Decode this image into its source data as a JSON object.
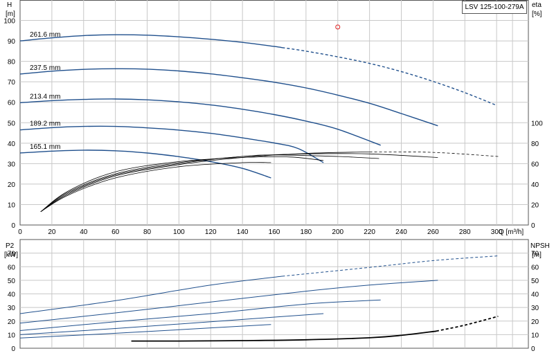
{
  "model": "LSV 125-100-279A",
  "chart_data": [
    {
      "type": "line",
      "title": "",
      "xlabel": "Q [m³/h]",
      "ylabel": "H [m]",
      "y2label": "eta [%]",
      "xlim": [
        0,
        320
      ],
      "ylim": [
        0,
        110
      ],
      "y2lim": [
        0,
        100
      ],
      "xticks": [
        0,
        20,
        40,
        60,
        80,
        100,
        120,
        140,
        160,
        180,
        200,
        220,
        240,
        260,
        280,
        300
      ],
      "yticks": [
        0,
        10,
        20,
        30,
        40,
        50,
        60,
        70,
        80,
        90,
        100
      ],
      "y2ticks": [
        0,
        20,
        40,
        60,
        80,
        100
      ],
      "grid": true,
      "left_unit_top": "H",
      "left_unit_bottom": "[m]",
      "right_unit_top": "eta",
      "right_unit_bottom": "[%]",
      "x_unit_label": "Q [m³/h]",
      "head_series": [
        {
          "name": "261.6 mm",
          "x": [
            0,
            20,
            40,
            60,
            80,
            100,
            120,
            140,
            160,
            180,
            200,
            220,
            240,
            260,
            280,
            300
          ],
          "y": [
            90,
            91.5,
            92.6,
            93,
            92.8,
            92,
            90.8,
            89.3,
            87.3,
            85,
            82.2,
            79,
            75,
            70.2,
            64.7,
            58.5
          ],
          "dashed_from": 165
        },
        {
          "name": "237.5 mm",
          "x": [
            0,
            20,
            40,
            60,
            80,
            100,
            120,
            140,
            160,
            180,
            200,
            220,
            240,
            263
          ],
          "y": [
            73.8,
            75.2,
            76.1,
            76.4,
            76.2,
            75.3,
            73.9,
            72,
            69.8,
            67,
            63.5,
            59.5,
            54.5,
            48.5
          ]
        },
        {
          "name": "213.4 mm",
          "x": [
            0,
            20,
            40,
            60,
            80,
            100,
            120,
            140,
            160,
            180,
            200,
            227
          ],
          "y": [
            59.8,
            60.8,
            61.4,
            61.6,
            61.2,
            60.2,
            58.7,
            56.6,
            54,
            50.8,
            46.8,
            39
          ]
        },
        {
          "name": "189.2 mm",
          "x": [
            0,
            20,
            40,
            60,
            80,
            100,
            120,
            140,
            160,
            175,
            191
          ],
          "y": [
            46.5,
            47.6,
            48.2,
            48.2,
            47.5,
            46.4,
            44.8,
            42.6,
            40.1,
            37.4,
            30.5
          ]
        },
        {
          "name": "165.1 mm",
          "x": [
            0,
            20,
            40,
            60,
            80,
            100,
            120,
            140,
            158
          ],
          "y": [
            35.2,
            36.1,
            36.6,
            36.3,
            35.2,
            33.4,
            31,
            27.7,
            23
          ]
        }
      ],
      "eta_series": [
        {
          "x": [
            13,
            30,
            60,
            100,
            140,
            170,
            191
          ],
          "y": [
            13,
            33,
            52,
            62,
            66,
            66.5,
            63
          ]
        },
        {
          "x": [
            13,
            30,
            60,
            100,
            140,
            160,
            200,
            226
          ],
          "y": [
            13,
            32,
            50,
            61,
            67,
            68.5,
            67,
            65
          ]
        },
        {
          "x": [
            13,
            30,
            60,
            100,
            140,
            180,
            220,
            263
          ],
          "y": [
            13,
            31,
            49,
            60,
            67,
            69.5,
            69.5,
            66
          ]
        },
        {
          "x": [
            13,
            30,
            60,
            100,
            140,
            180,
            220,
            260,
            301
          ],
          "y": [
            13,
            30,
            48,
            59,
            66,
            70,
            71.5,
            71,
            67
          ],
          "dashed_from": 220
        },
        {
          "x": [
            13,
            30,
            60,
            100,
            140,
            158
          ],
          "y": [
            13,
            29,
            46,
            57,
            61,
            61
          ]
        }
      ],
      "marker": {
        "x": 200,
        "y": 96.8,
        "color": "#e02020"
      }
    },
    {
      "type": "line",
      "title": "",
      "xlabel": "",
      "ylabel": "P2 [kW]",
      "y2label": "NPSH [m]",
      "xlim": [
        0,
        320
      ],
      "ylim": [
        0,
        80
      ],
      "yticks": [
        0,
        10,
        20,
        30,
        40,
        50,
        60,
        70
      ],
      "y2ticks": [
        0,
        10,
        20,
        30,
        40,
        50,
        60,
        70
      ],
      "grid": true,
      "left_unit_top": "P2",
      "left_unit_bottom": "[kW]",
      "right_unit_top": "NPSH",
      "right_unit_bottom": "[m]",
      "power_series": [
        {
          "x": [
            0,
            60,
            120,
            165,
            220,
            260,
            301
          ],
          "y": [
            25.5,
            35,
            46.5,
            53,
            59.5,
            64.5,
            68
          ],
          "dashed_from": 165
        },
        {
          "x": [
            0,
            60,
            120,
            180,
            220,
            263
          ],
          "y": [
            18.5,
            26,
            34,
            42,
            46.5,
            50
          ]
        },
        {
          "x": [
            0,
            60,
            120,
            180,
            227
          ],
          "y": [
            13,
            19.5,
            25.5,
            32.5,
            35.5
          ]
        },
        {
          "x": [
            0,
            60,
            120,
            191
          ],
          "y": [
            10,
            14.5,
            19.5,
            25.5
          ]
        },
        {
          "x": [
            0,
            60,
            120,
            158
          ],
          "y": [
            7.5,
            11,
            15,
            17.5
          ]
        }
      ],
      "npsh_series": [
        {
          "x": [
            70,
            100,
            140,
            180,
            220,
            240,
            262,
            280,
            301
          ],
          "y": [
            5.3,
            5.3,
            5.6,
            6.2,
            7.7,
            9.5,
            12.6,
            17,
            23.5
          ],
          "dashed_from": 262
        }
      ]
    }
  ],
  "colors": {
    "grid": "#c8c8c8",
    "axis": "#555555",
    "head": "#1f4f8c",
    "eta": "#000000",
    "npsh": "#000000",
    "box_border": "#555555"
  }
}
